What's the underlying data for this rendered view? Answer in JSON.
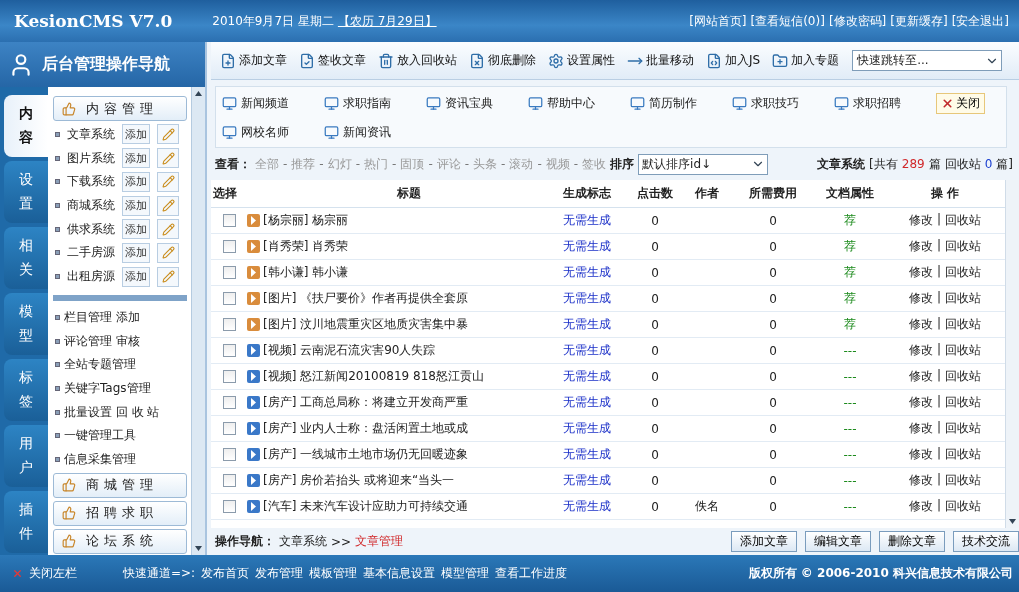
{
  "header": {
    "logo": "KesionCMS V7.0",
    "date": "2010年9月7日 星期二",
    "lunar": "【农历 7月29日】",
    "links": [
      "[网站首页]",
      "[查看短信(0)]",
      "[修改密码]",
      "[更新缓存]",
      "[安全退出]"
    ]
  },
  "sidebar": {
    "title": "后台管理操作导航",
    "tabs": [
      {
        "label": "内容",
        "selected": true
      },
      {
        "label": "设置",
        "selected": false
      },
      {
        "label": "相关",
        "selected": false
      },
      {
        "label": "模型",
        "selected": false
      },
      {
        "label": "标签",
        "selected": false
      },
      {
        "label": "用户",
        "selected": false
      },
      {
        "label": "插件",
        "selected": false
      }
    ],
    "group": "内容管理",
    "systems": [
      {
        "label": "文章系统",
        "add": "添加"
      },
      {
        "label": "图片系统",
        "add": "添加"
      },
      {
        "label": "下载系统",
        "add": "添加"
      },
      {
        "label": "商城系统",
        "add": "添加"
      },
      {
        "label": "供求系统",
        "add": "添加"
      },
      {
        "label": "二手房源",
        "add": "添加"
      },
      {
        "label": "出租房源",
        "add": "添加"
      }
    ],
    "items": [
      "栏目管理 添加",
      "评论管理 审核",
      "全站专题管理",
      "关键字Tags管理",
      "批量设置 回 收 站",
      "一键管理工具",
      "信息采集管理"
    ],
    "groups": [
      "商城管理",
      "招聘求职",
      "论坛系统"
    ]
  },
  "toolbar": {
    "buttons": [
      "添加文章",
      "签收文章",
      "放入回收站",
      "彻底删除",
      "设置属性",
      "批量移动",
      "加入JS",
      "加入专题"
    ],
    "jump": "快速跳转至..."
  },
  "channels": {
    "items": [
      "新闻频道",
      "求职指南",
      "资讯宝典",
      "帮助中心",
      "简历制作",
      "求职技巧",
      "求职招聘",
      "网校名师",
      "新闻资讯"
    ],
    "close": "关闭"
  },
  "filter": {
    "label": "查看：",
    "options": [
      {
        "label": "全部"
      },
      {
        "sep": "-",
        "label": "推荐"
      },
      {
        "sep": "-",
        "label": "幻灯"
      },
      {
        "sep": "-",
        "label": "热门"
      },
      {
        "sep": "-",
        "label": "固顶"
      },
      {
        "sep": "-",
        "label": "评论"
      },
      {
        "sep": "-",
        "label": "头条"
      },
      {
        "sep": "-",
        "label": "滚动"
      },
      {
        "sep": "-",
        "label": "视频"
      },
      {
        "sep": "-",
        "label": "签收"
      }
    ],
    "sort_label": "排序",
    "sort": "默认排序id↓",
    "system": "文章系统",
    "total_prefix": "[共有",
    "total": "289",
    "total_unit": "篇",
    "recycle": "回收站",
    "recycle_count": "0",
    "recycle_unit": "篇]"
  },
  "table": {
    "columns": [
      "选择",
      "标题",
      "生成标志",
      "点击数",
      "作者",
      "所需费用",
      "文档属性",
      "操 作"
    ],
    "rows": [
      {
        "checked": false,
        "color": "#d98c3c",
        "sep": "|",
        "title": "[杨宗丽] 杨宗丽",
        "flag": "无需生成",
        "hits": "0",
        "author": "",
        "fee": "0",
        "attr": "荐",
        "edit": "修改",
        "recycle": "回收站"
      },
      {
        "checked": false,
        "color": "#d98c3c",
        "sep": "|",
        "title": "[肖秀荣] 肖秀荣",
        "flag": "无需生成",
        "hits": "0",
        "author": "",
        "fee": "0",
        "attr": "荐",
        "edit": "修改",
        "recycle": "回收站"
      },
      {
        "checked": false,
        "color": "#d98c3c",
        "sep": "|",
        "title": "[韩小谦] 韩小谦",
        "flag": "无需生成",
        "hits": "0",
        "author": "",
        "fee": "0",
        "attr": "荐",
        "edit": "修改",
        "recycle": "回收站"
      },
      {
        "checked": false,
        "color": "#d98c3c",
        "sep": "|",
        "title": "[图片] 《扶尸要价》作者再提供全套原",
        "flag": "无需生成",
        "hits": "0",
        "author": "",
        "fee": "0",
        "attr": "荐",
        "edit": "修改",
        "recycle": "回收站"
      },
      {
        "checked": false,
        "color": "#d98c3c",
        "sep": "|",
        "title": "[图片] 汶川地震重灾区地质灾害集中暴",
        "flag": "无需生成",
        "hits": "0",
        "author": "",
        "fee": "0",
        "attr": "荐",
        "edit": "修改",
        "recycle": "回收站"
      },
      {
        "checked": false,
        "color": "#3a78c8",
        "sep": "|",
        "title": "[视频] 云南泥石流灾害90人失踪",
        "flag": "无需生成",
        "hits": "0",
        "author": "",
        "fee": "0",
        "attr": "---",
        "edit": "修改",
        "recycle": "回收站"
      },
      {
        "checked": false,
        "color": "#3a78c8",
        "sep": "|",
        "title": "[视频] 怒江新闻20100819 818怒江贡山",
        "flag": "无需生成",
        "hits": "0",
        "author": "",
        "fee": "0",
        "attr": "---",
        "edit": "修改",
        "recycle": "回收站"
      },
      {
        "checked": false,
        "color": "#3a78c8",
        "sep": "|",
        "title": "[房产] 工商总局称：将建立开发商严重",
        "flag": "无需生成",
        "hits": "0",
        "author": "",
        "fee": "0",
        "attr": "---",
        "edit": "修改",
        "recycle": "回收站"
      },
      {
        "checked": false,
        "color": "#3a78c8",
        "sep": "|",
        "title": "[房产] 业内人士称：盘活闲置土地或成",
        "flag": "无需生成",
        "hits": "0",
        "author": "",
        "fee": "0",
        "attr": "---",
        "edit": "修改",
        "recycle": "回收站"
      },
      {
        "checked": false,
        "color": "#3a78c8",
        "sep": "|",
        "title": "[房产] 一线城市土地市场仍无回暖迹象",
        "flag": "无需生成",
        "hits": "0",
        "author": "",
        "fee": "0",
        "attr": "---",
        "edit": "修改",
        "recycle": "回收站"
      },
      {
        "checked": false,
        "color": "#3a78c8",
        "sep": "|",
        "title": "[房产] 房价若抬头 或将迎来“当头一",
        "flag": "无需生成",
        "hits": "0",
        "author": "",
        "fee": "0",
        "attr": "---",
        "edit": "修改",
        "recycle": "回收站"
      },
      {
        "checked": false,
        "color": "#3a78c8",
        "sep": "|",
        "title": "[汽车] 未来汽车设计应助力可持续交通",
        "flag": "无需生成",
        "hits": "0",
        "author": "佚名",
        "fee": "0",
        "attr": "---",
        "edit": "修改",
        "recycle": "回收站"
      }
    ]
  },
  "breadcrumb": {
    "label": "操作导航：",
    "parent": "文章系统",
    "sep": ">>",
    "current": "文章管理"
  },
  "actions": [
    "添加文章",
    "编辑文章",
    "删除文章",
    "技术交流"
  ],
  "footer": {
    "close_left": "关闭左栏",
    "quick": "快速通道=>:",
    "links": [
      "发布首页",
      "发布管理",
      "模板管理",
      "基本信息设置",
      "模型管理",
      "查看工作进度"
    ],
    "copyright": "版权所有 © 2006-2010 科兴信息技术有限公司"
  }
}
